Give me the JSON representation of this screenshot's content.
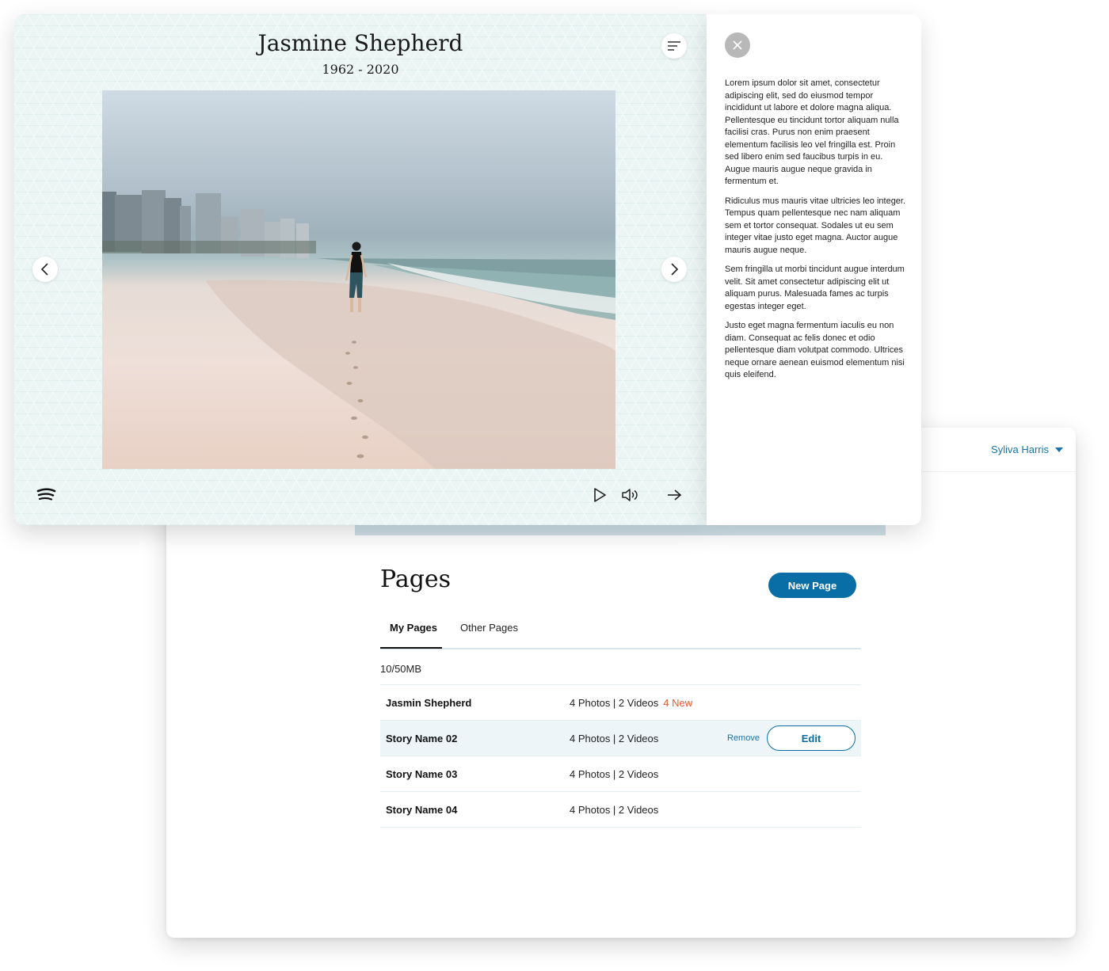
{
  "dashboard": {
    "user_name": "Syliva Harris",
    "title": "Pages",
    "new_page_label": "New Page",
    "tabs": [
      {
        "label": "My Pages",
        "active": true
      },
      {
        "label": "Other Pages",
        "active": false
      }
    ],
    "storage": "10/50MB",
    "rows": [
      {
        "name": "Jasmin Shepherd",
        "meta": "4 Photos | 2 Videos",
        "badge": "4 New"
      },
      {
        "name": "Story Name 02",
        "meta": "4 Photos | 2 Videos",
        "remove_label": "Remove",
        "edit_label": "Edit"
      },
      {
        "name": "Story Name 03",
        "meta": "4 Photos | 2 Videos"
      },
      {
        "name": "Story Name 04",
        "meta": "4 Photos | 2 Videos"
      }
    ]
  },
  "viewer": {
    "name": "Jasmine Shepherd",
    "dates": "1962 - 2020",
    "icons": [
      "menu-icon",
      "chevron-left-icon",
      "chevron-right-icon",
      "spotify-icon",
      "play-icon",
      "volume-icon",
      "arrow-right-icon",
      "close-icon"
    ]
  },
  "bio": {
    "paragraphs": [
      "Lorem ipsum dolor sit amet, consectetur adipiscing elit, sed do eiusmod tempor incididunt ut labore et dolore magna aliqua. Pellentesque eu tincidunt tortor aliquam nulla facilisi cras. Purus non enim praesent elementum facilisis leo vel fringilla est. Proin sed libero enim sed faucibus turpis in eu. Augue mauris augue neque gravida in fermentum et.",
      "Ridiculus mus mauris vitae ultricies leo integer. Tempus quam pellentesque nec nam aliquam sem et tortor consequat. Sodales ut eu sem integer vitae justo eget magna. Auctor augue mauris augue neque.",
      "Sem fringilla ut morbi tincidunt augue interdum velit. Sit amet consectetur adipiscing elit ut aliquam purus. Malesuada fames ac turpis egestas integer eget.",
      "Justo eget magna fermentum iaculis eu non diam. Consequat ac felis donec et odio pellentesque diam volutpat commodo. Ultrices neque ornare aenean euismod elementum nisi quis eleifend."
    ]
  },
  "colors": {
    "accent": "#0a6ea6",
    "new_badge": "#e15a2d",
    "viewer_bg": "#eaf5f4",
    "row_highlight": "#edf5f8"
  }
}
